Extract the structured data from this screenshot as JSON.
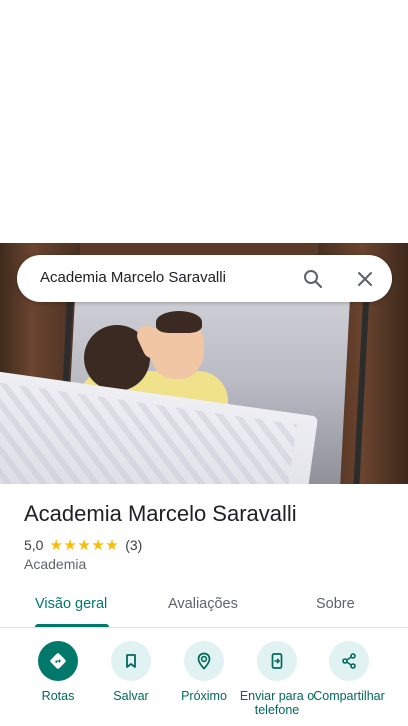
{
  "search": {
    "value": "Academia Marcelo Saravalli"
  },
  "place": {
    "title": "Academia Marcelo Saravalli",
    "rating": "5,0",
    "stars": 5,
    "review_count": "(3)",
    "category": "Academia"
  },
  "tabs": [
    {
      "label": "Visão geral",
      "active": true
    },
    {
      "label": "Avaliações",
      "active": false
    },
    {
      "label": "Sobre",
      "active": false
    }
  ],
  "actions": [
    {
      "label": "Rotas",
      "icon": "directions-icon"
    },
    {
      "label": "Salvar",
      "icon": "bookmark-icon"
    },
    {
      "label": "Próximo",
      "icon": "nearby-icon"
    },
    {
      "label": "Enviar para o telefone",
      "icon": "send-to-phone-icon"
    },
    {
      "label": "Compartilhar",
      "icon": "share-icon"
    }
  ],
  "colors": {
    "accent": "#00796b",
    "action_bg": "#e0f2f1",
    "star": "#fbbc04"
  }
}
